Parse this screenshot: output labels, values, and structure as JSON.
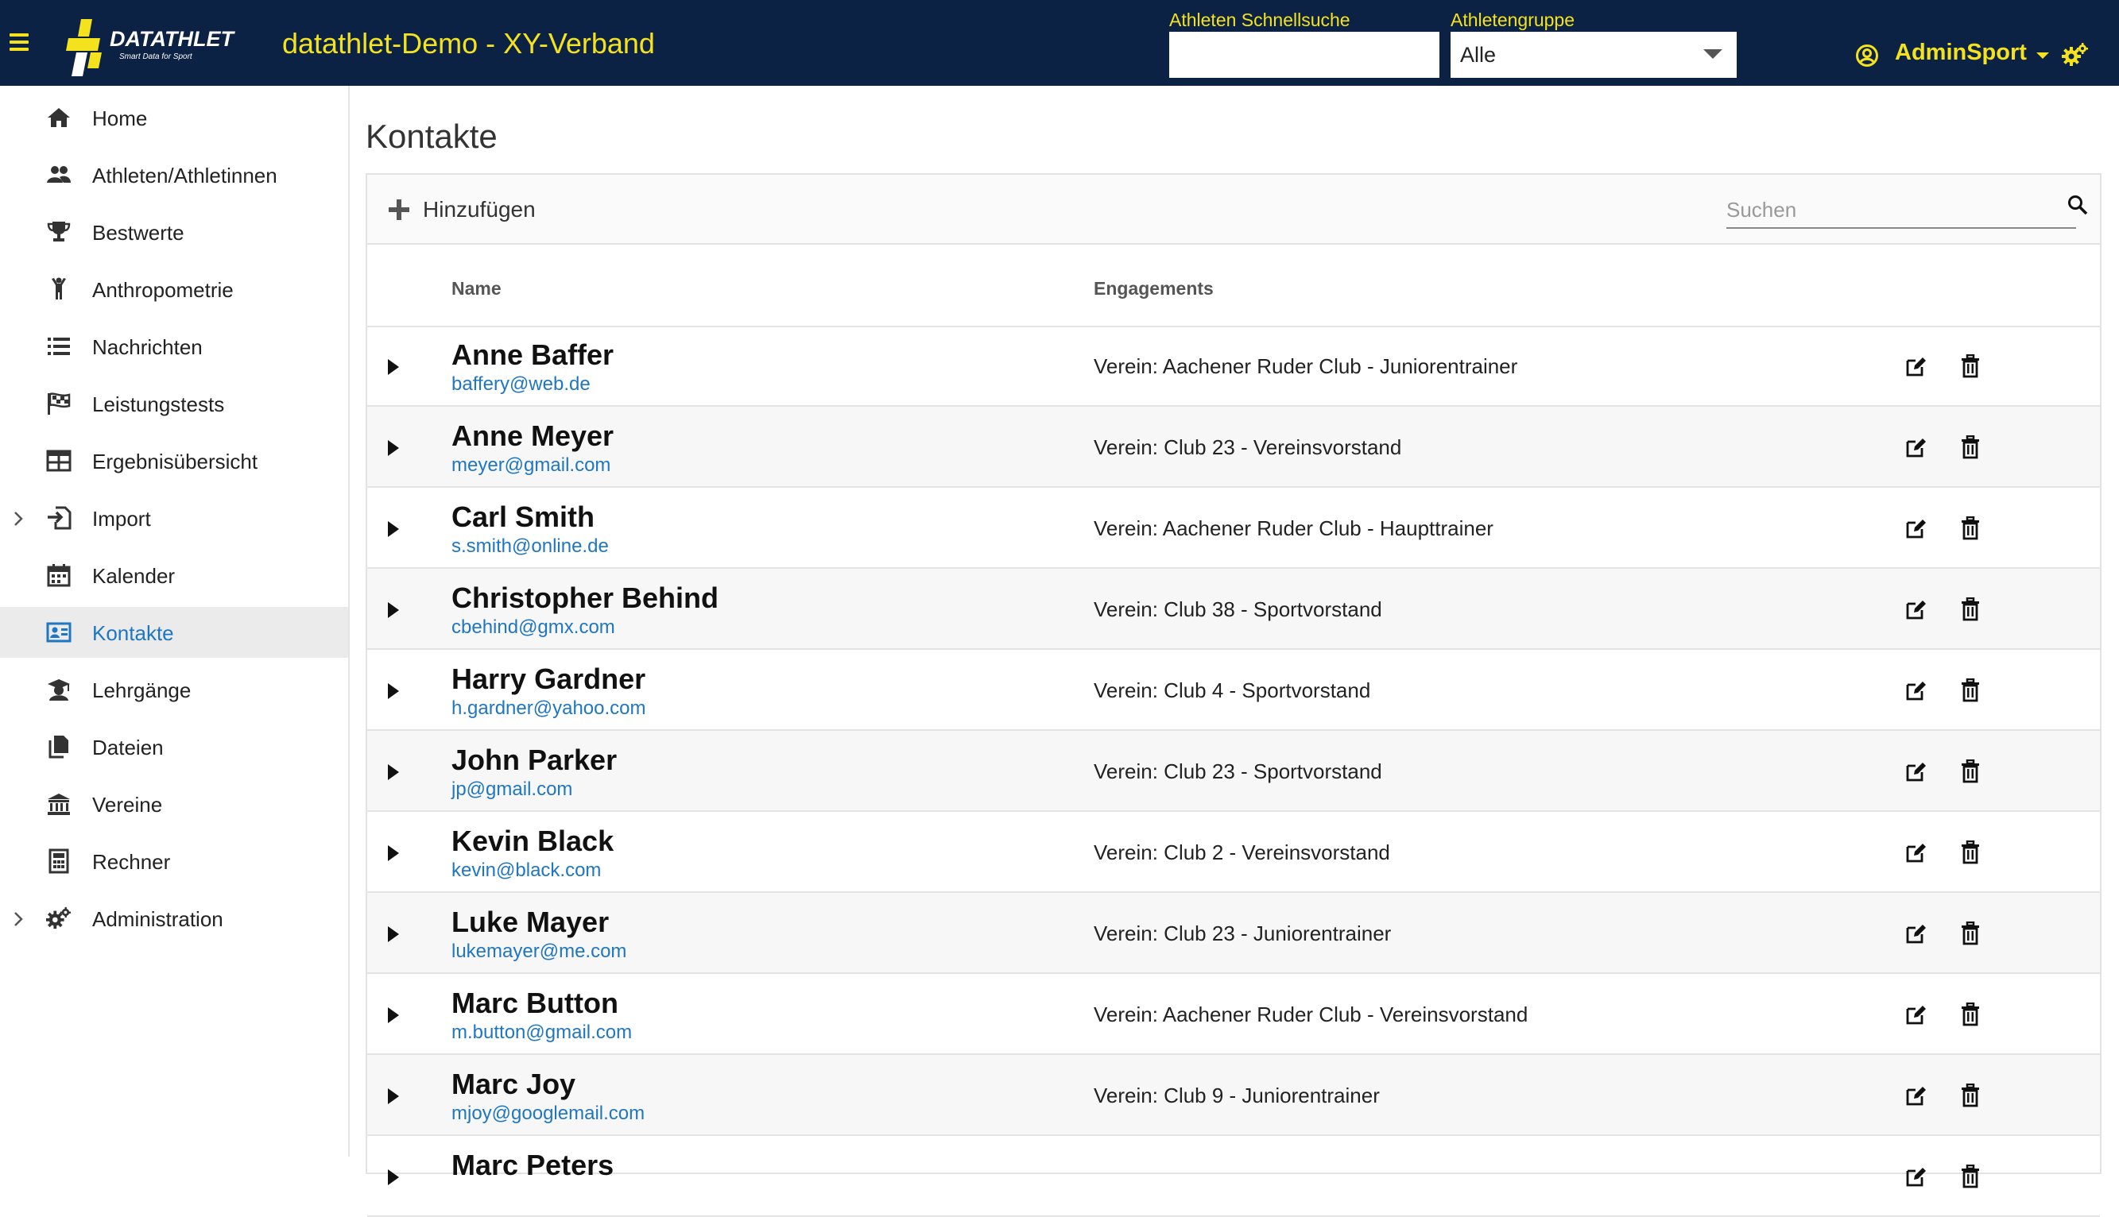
{
  "header": {
    "app_title": "datathlet-Demo - XY-Verband",
    "logo_text": "DATATHLET",
    "logo_tagline": "Smart Data for Sport",
    "quick_search_label": "Athleten Schnellsuche",
    "quick_search_value": "",
    "group_label": "Athletengruppe",
    "group_value": "Alle",
    "user_name": "AdminSport"
  },
  "sidebar": {
    "items": [
      {
        "label": "Home",
        "icon": "home-icon"
      },
      {
        "label": "Athleten/Athletinnen",
        "icon": "users-icon"
      },
      {
        "label": "Bestwerte",
        "icon": "trophy-icon"
      },
      {
        "label": "Anthropometrie",
        "icon": "person-icon"
      },
      {
        "label": "Nachrichten",
        "icon": "list-icon"
      },
      {
        "label": "Leistungstests",
        "icon": "flag-icon"
      },
      {
        "label": "Ergebnisübersicht",
        "icon": "table-icon"
      },
      {
        "label": "Import",
        "icon": "import-icon"
      },
      {
        "label": "Kalender",
        "icon": "calendar-icon"
      },
      {
        "label": "Kontakte",
        "icon": "contact-card-icon"
      },
      {
        "label": "Lehrgänge",
        "icon": "graduate-icon"
      },
      {
        "label": "Dateien",
        "icon": "files-icon"
      },
      {
        "label": "Vereine",
        "icon": "bank-icon"
      },
      {
        "label": "Rechner",
        "icon": "calculator-icon"
      },
      {
        "label": "Administration",
        "icon": "cogs-icon"
      }
    ],
    "active": "Kontakte"
  },
  "main": {
    "title": "Kontakte",
    "add_label": "Hinzufügen",
    "search_placeholder": "Suchen",
    "columns": {
      "name": "Name",
      "engagements": "Engagements"
    },
    "rows": [
      {
        "name": "Anne Baffer",
        "email": "baffery@web.de",
        "engagement": "Verein: Aachener Ruder Club - Juniorentrainer"
      },
      {
        "name": "Anne Meyer",
        "email": "meyer@gmail.com",
        "engagement": "Verein: Club 23 - Vereinsvorstand"
      },
      {
        "name": "Carl Smith",
        "email": "s.smith@online.de",
        "engagement": "Verein: Aachener Ruder Club - Haupttrainer"
      },
      {
        "name": "Christopher Behind",
        "email": "cbehind@gmx.com",
        "engagement": "Verein: Club 38 - Sportvorstand"
      },
      {
        "name": "Harry Gardner",
        "email": "h.gardner@yahoo.com",
        "engagement": "Verein: Club 4 - Sportvorstand"
      },
      {
        "name": "John Parker",
        "email": "jp@gmail.com",
        "engagement": "Verein: Club 23 - Sportvorstand"
      },
      {
        "name": "Kevin Black",
        "email": "kevin@black.com",
        "engagement": "Verein: Club 2 - Vereinsvorstand"
      },
      {
        "name": "Luke Mayer",
        "email": "lukemayer@me.com",
        "engagement": "Verein: Club 23 - Juniorentrainer"
      },
      {
        "name": "Marc Button",
        "email": "m.button@gmail.com",
        "engagement": "Verein: Aachener Ruder Club - Vereinsvorstand"
      },
      {
        "name": "Marc Joy",
        "email": "mjoy@googlemail.com",
        "engagement": "Verein: Club 9 - Juniorentrainer"
      },
      {
        "name": "Marc Peters",
        "email": "",
        "engagement": ""
      }
    ]
  },
  "colors": {
    "header_bg": "#0c2245",
    "accent_yellow": "#f3e21d",
    "link_blue": "#1f76c2",
    "active_bg": "#ebebeb"
  }
}
